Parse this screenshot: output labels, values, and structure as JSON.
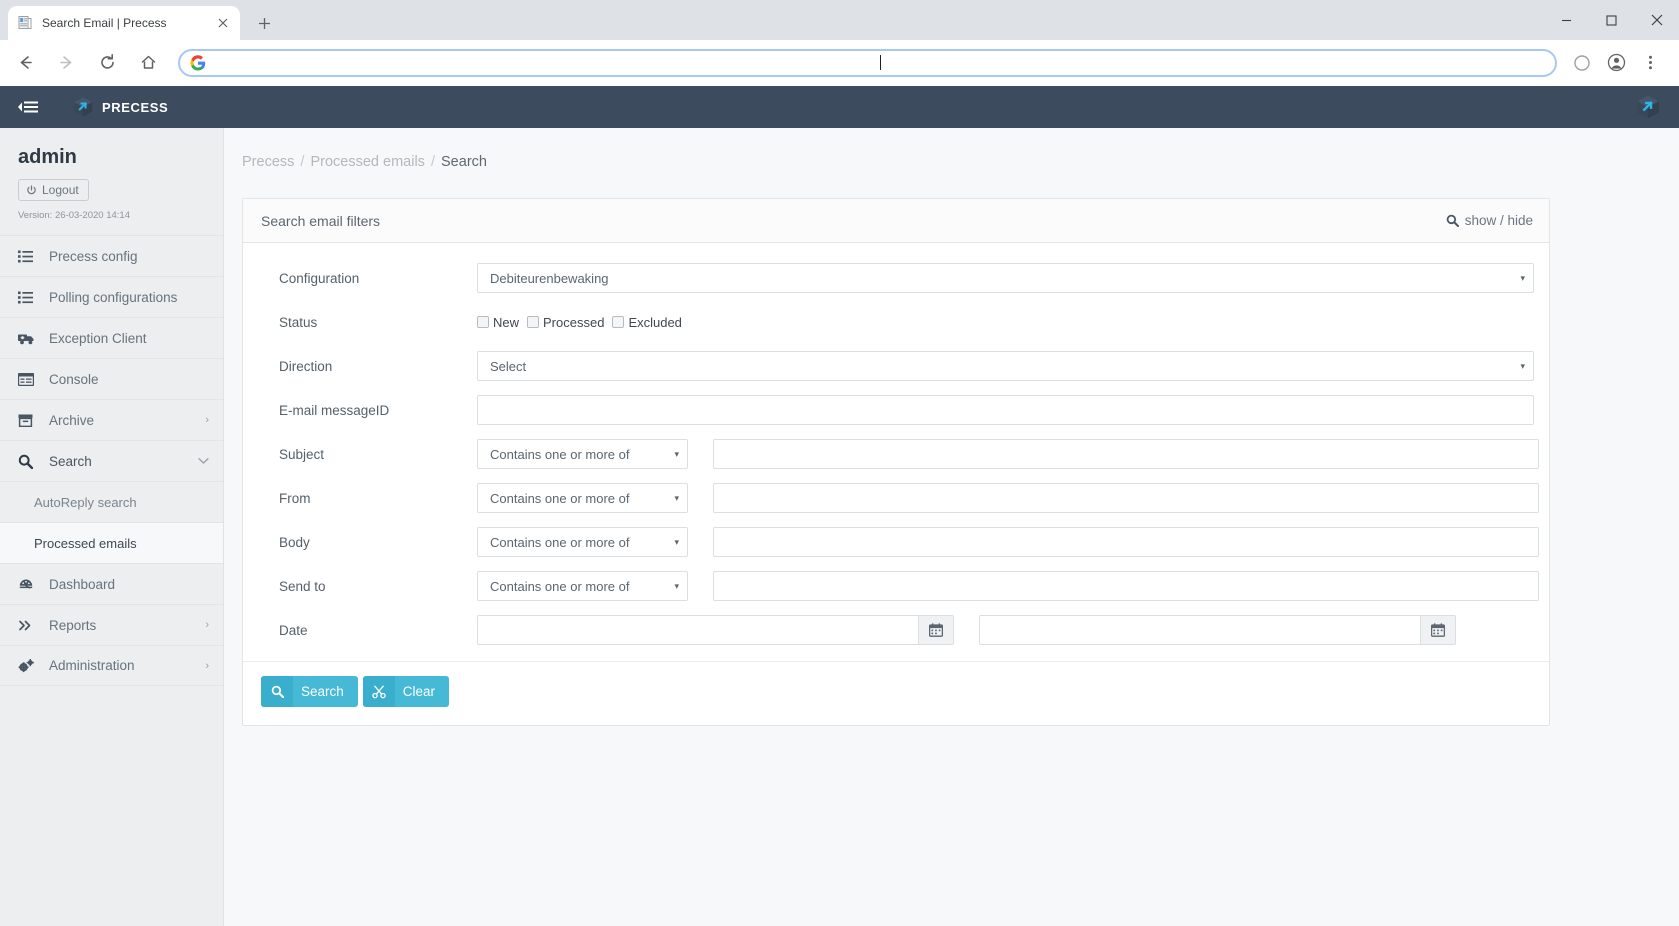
{
  "browser": {
    "tab": {
      "title": "Search Email | Precess",
      "favicon_icon": "document-icon",
      "close_icon": "close-icon"
    },
    "newtab_label": "+",
    "window_controls": {
      "minimize_icon": "minimize-icon",
      "maximize_icon": "maximize-icon",
      "close_icon": "window-close-icon"
    },
    "nav": {
      "back_icon": "back-arrow-icon",
      "forward_icon": "forward-arrow-icon",
      "reload_icon": "reload-icon",
      "home_icon": "home-icon"
    },
    "omnibox": {
      "value": "",
      "placeholder": "",
      "search_engine_icon": "google-g-icon"
    },
    "profile_icon": "profile-avatar-icon",
    "menu_icon": "three-dot-menu-icon",
    "extension_icon": "extension-circle-icon"
  },
  "topnav": {
    "toggle_icon": "sidebar-collapse-icon",
    "brand": "PRECESS",
    "brand_logo_icon": "precess-cube-logo-icon",
    "right_logo_icon": "precess-cube-logo-icon"
  },
  "sidebar": {
    "username": "admin",
    "logout_label": "Logout",
    "logout_icon": "power-icon",
    "version": "Version: 26-03-2020 14:14",
    "items": [
      {
        "label": "Precess config",
        "icon": "list-icon",
        "caret": "",
        "level": 0,
        "active": false
      },
      {
        "label": "Polling configurations",
        "icon": "list-icon",
        "caret": "",
        "level": 0,
        "active": false
      },
      {
        "label": "Exception Client",
        "icon": "truck-icon",
        "caret": "",
        "level": 0,
        "active": false
      },
      {
        "label": "Console",
        "icon": "window-icon",
        "caret": "",
        "level": 0,
        "active": false
      },
      {
        "label": "Archive",
        "icon": "archive-box-icon",
        "caret": "›",
        "level": 0,
        "active": false
      },
      {
        "label": "Search",
        "icon": "search-icon",
        "caret": "⌄",
        "level": 0,
        "active": false,
        "open": true
      },
      {
        "label": "AutoReply search",
        "icon": "",
        "caret": "",
        "level": 1,
        "active": false
      },
      {
        "label": "Processed emails",
        "icon": "",
        "caret": "",
        "level": 1,
        "active": true
      },
      {
        "label": "Dashboard",
        "icon": "dashboard-icon",
        "caret": "",
        "level": 0,
        "active": false
      },
      {
        "label": "Reports",
        "icon": "chevrons-right-icon",
        "caret": "›",
        "level": 0,
        "active": false
      },
      {
        "label": "Administration",
        "icon": "gears-icon",
        "caret": "›",
        "level": 0,
        "active": false
      }
    ]
  },
  "breadcrumb": {
    "root": "Precess",
    "parent": "Processed emails",
    "current": "Search",
    "separator": "/"
  },
  "panel": {
    "title": "Search email filters",
    "showhide_label": "show / hide",
    "showhide_icon": "search-icon"
  },
  "form": {
    "configuration": {
      "label": "Configuration",
      "value": "Debiteurenbewaking",
      "arrow": "▾"
    },
    "status": {
      "label": "Status",
      "options": [
        {
          "label": "New",
          "checked": false
        },
        {
          "label": "Processed",
          "checked": false
        },
        {
          "label": "Excluded",
          "checked": false
        }
      ]
    },
    "direction": {
      "label": "Direction",
      "value": "Select",
      "arrow": "▾"
    },
    "messageid": {
      "label": "E-mail messageID",
      "value": "",
      "placeholder": ""
    },
    "subject": {
      "label": "Subject",
      "condition": "Contains one or more of",
      "arrow": "▾",
      "value": "",
      "placeholder": ""
    },
    "from": {
      "label": "From",
      "condition": "Contains one or more of",
      "arrow": "▾",
      "value": "",
      "placeholder": ""
    },
    "body": {
      "label": "Body",
      "condition": "Contains one or more of",
      "arrow": "▾",
      "value": "",
      "placeholder": ""
    },
    "sendto": {
      "label": "Send to",
      "condition": "Contains one or more of",
      "arrow": "▾",
      "value": "",
      "placeholder": ""
    },
    "date": {
      "label": "Date",
      "from_value": "",
      "to_value": "",
      "calendar_icon": "calendar-icon"
    }
  },
  "actions": {
    "search_label": "Search",
    "search_icon": "search-icon",
    "clear_label": "Clear",
    "clear_icon": "scissors-icon"
  },
  "colors": {
    "navbar": "#3d4b5f",
    "sidebar": "#eceeef",
    "accent": "#45b9d6",
    "accent_dark": "#3aafcd",
    "brand_cyan": "#29b6e8",
    "text": "#55606a"
  }
}
